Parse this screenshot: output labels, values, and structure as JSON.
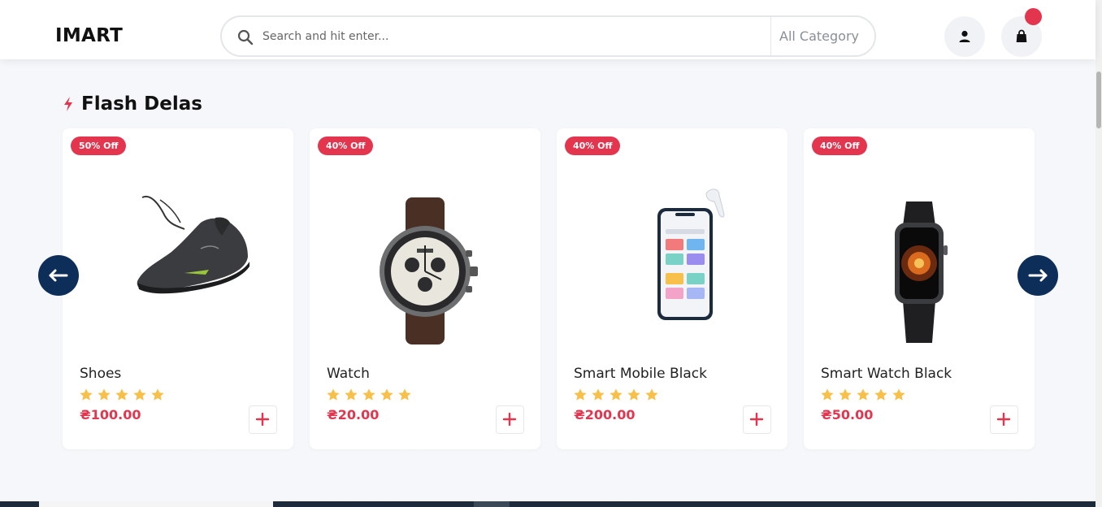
{
  "header": {
    "logo": "IMART",
    "search_placeholder": "Search and hit enter...",
    "category_label": "All Category"
  },
  "section": {
    "title": "Flash Delas"
  },
  "products": [
    {
      "name": "Shoes",
      "price": "₴100.00",
      "badge": "50% Off",
      "rating": 5,
      "image_icon": "shoe-icon"
    },
    {
      "name": "Watch",
      "price": "₴20.00",
      "badge": "40% Off",
      "rating": 5,
      "image_icon": "watch-icon"
    },
    {
      "name": "Smart Mobile Black",
      "price": "₴200.00",
      "badge": "40% Off",
      "rating": 5,
      "image_icon": "smartphone-icon"
    },
    {
      "name": "Smart Watch Black",
      "price": "₴50.00",
      "badge": "40% Off",
      "rating": 5,
      "image_icon": "smartwatch-icon"
    }
  ],
  "colors": {
    "accent": "#e3364e",
    "navy": "#0d2e59",
    "star": "#f7c04a"
  }
}
